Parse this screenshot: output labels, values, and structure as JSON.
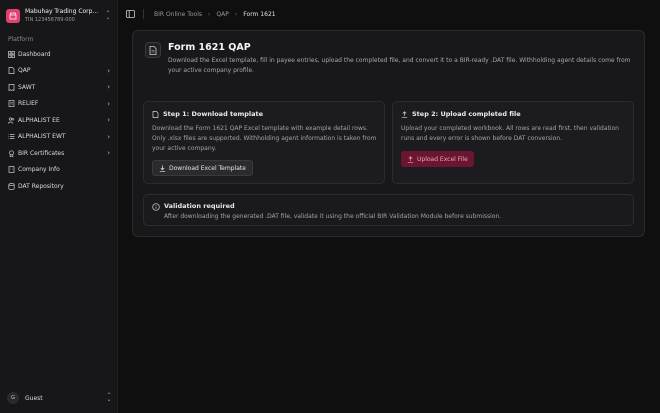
{
  "sidebar": {
    "company_name": "Mabuhay Trading Corp...",
    "company_tin": "TIN 123456789-000",
    "section_label": "Platform",
    "items": [
      {
        "label": "Dashboard",
        "icon": "grid-icon",
        "chevron": false
      },
      {
        "label": "QAP",
        "icon": "document-icon",
        "chevron": true
      },
      {
        "label": "SAWT",
        "icon": "receipt-icon",
        "chevron": true
      },
      {
        "label": "RELIEF",
        "icon": "file-icon",
        "chevron": true
      },
      {
        "label": "ALPHALIST EE",
        "icon": "users-icon",
        "chevron": true
      },
      {
        "label": "ALPHALIST EWT",
        "icon": "list-icon",
        "chevron": true
      },
      {
        "label": "BIR Certificates",
        "icon": "certificate-icon",
        "chevron": true
      },
      {
        "label": "Company Info",
        "icon": "building-icon",
        "chevron": false
      },
      {
        "label": "DAT Repository",
        "icon": "database-icon",
        "chevron": false
      }
    ],
    "user": {
      "initial": "G",
      "name": "Guest"
    }
  },
  "breadcrumb": {
    "items": [
      "BIR Online Tools",
      "QAP",
      "Form 1621"
    ]
  },
  "main": {
    "title": "Form 1621 QAP",
    "description": "Download the Excel template, fill in payee entries, upload the completed file, and convert it to a BIR-ready .DAT file. Withholding agent details come from your active company profile.",
    "step1": {
      "title": "Step 1: Download template",
      "description": "Download the Form 1621 QAP Excel template with example detail rows. Only .xlsx files are supported. Withholding agent information is taken from your active company.",
      "button": "Download Excel Template"
    },
    "step2": {
      "title": "Step 2: Upload completed file",
      "description": "Upload your completed workbook. All rows are read first, then validation runs and every error is shown before DAT conversion.",
      "button": "Upload Excel File"
    },
    "notice": {
      "title": "Validation required",
      "text": "After downloading the generated .DAT file, validate it using the official BIR Validation Module before submission."
    }
  },
  "colors": {
    "brand": "#e33f6f",
    "upload_button": "#6b1531"
  }
}
